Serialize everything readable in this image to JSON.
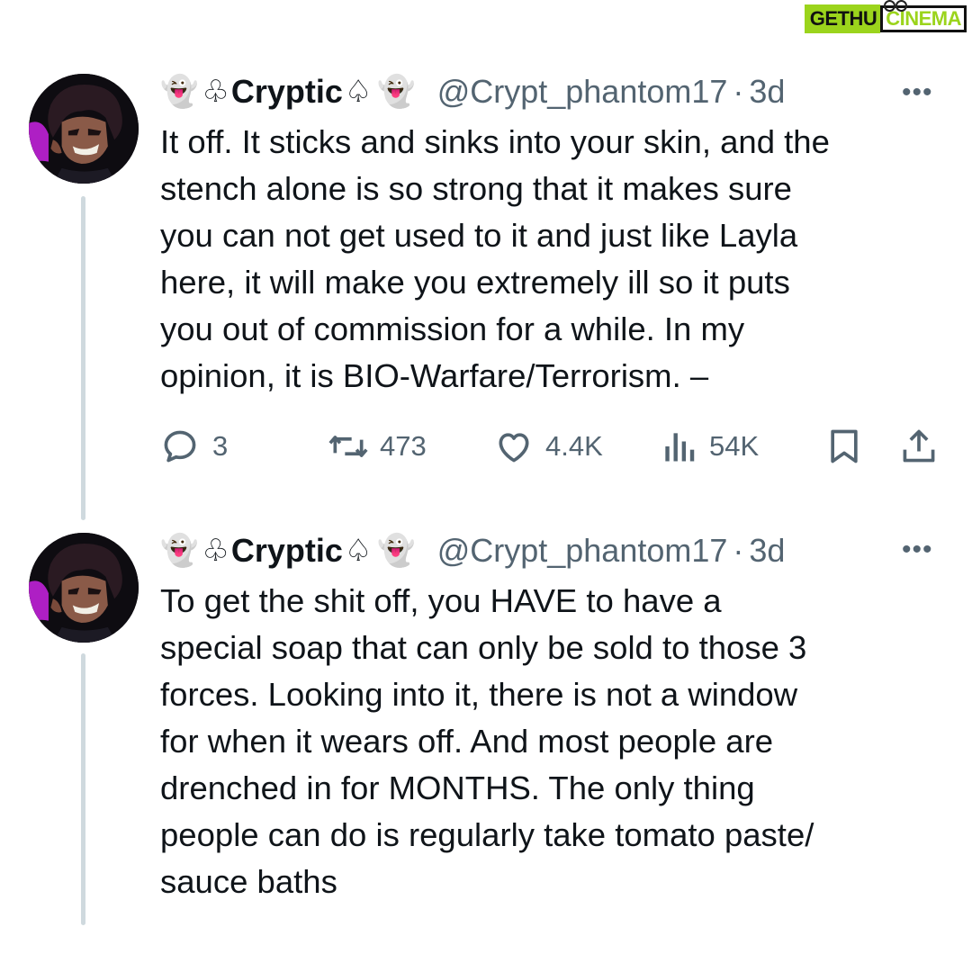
{
  "watermark": {
    "left": "GETHU",
    "right": "CINEMA"
  },
  "tweets": [
    {
      "author": {
        "emoji_left": "👻",
        "club": "♧",
        "name": "Cryptic",
        "spade": "♤",
        "emoji_right": "👻",
        "handle": "@Crypt_phantom17",
        "separator": "·",
        "time": "3d"
      },
      "more": "•••",
      "lines": [
        "It off. It sticks and sinks into your skin, and the",
        "stench alone is so strong that it makes sure",
        "you can not get used to it and just like Layla",
        "here, it will make you extremely ill so it puts",
        "you out of commission for a while. In my",
        "opinion, it is BIO-Warfare/Terrorism. –"
      ],
      "actions": {
        "replies": "3",
        "reposts": "473",
        "likes": "4.4K",
        "views": "54K"
      },
      "icons": [
        "reply-icon",
        "repost-icon",
        "like-icon",
        "views-icon",
        "bookmark-icon",
        "share-icon"
      ]
    },
    {
      "author": {
        "emoji_left": "👻",
        "club": "♧",
        "name": "Cryptic",
        "spade": "♤",
        "emoji_right": "👻",
        "handle": "@Crypt_phantom17",
        "separator": "·",
        "time": "3d"
      },
      "more": "•••",
      "lines": [
        "To get the shit off, you HAVE to have a",
        "special soap that can only be sold to those 3",
        "forces. Looking into it, there is not a window",
        "for when it wears off. And most people are",
        "drenched in for MONTHS. The only thing",
        "people can do is regularly take tomato paste/",
        "sauce baths"
      ]
    }
  ],
  "colors": {
    "text": "#0f1419",
    "muted": "#536471",
    "thread_line": "#cfd9de",
    "watermark_green": "#9bd41c"
  }
}
